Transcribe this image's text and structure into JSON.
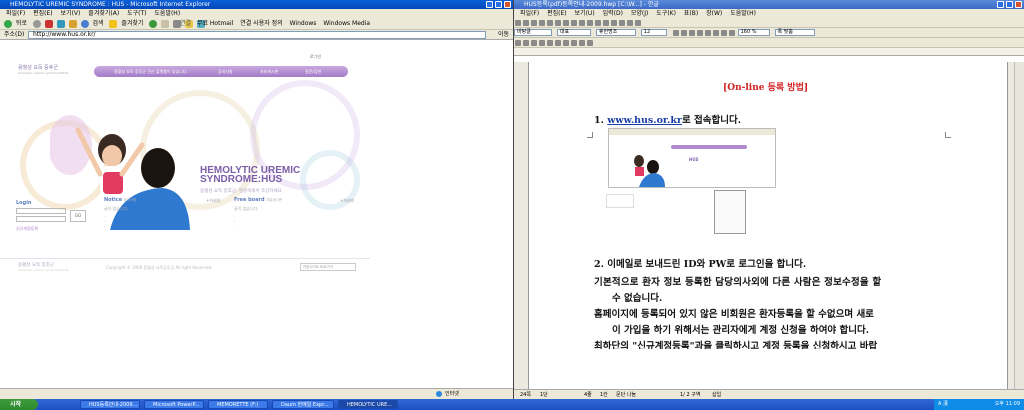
{
  "ie": {
    "title": "HEMOLYTIC UREMIC SYNDROME : HUS - Microsoft Internet Explorer",
    "menu": [
      "파일(F)",
      "편집(E)",
      "보기(V)",
      "즐겨찾기(A)",
      "도구(T)",
      "도움말(H)"
    ],
    "toolbar": {
      "back": "뒤로",
      "search": "검색",
      "favorites": "즐겨찾기"
    },
    "links": {
      "label": "연결",
      "items": [
        "무료 Hotmail",
        "연결 사용자 정의",
        "Windows",
        "Windows Media"
      ]
    },
    "address_label": "주소(D)",
    "address": "http://www.hus.or.kr/",
    "go": "이동",
    "status": "인터넷"
  },
  "site": {
    "utility": "로그인",
    "logo": "용혈성 요독 증후군",
    "logo_sub": "hemolytic uremic syndrome(HUS)",
    "nav": [
      "용혈성 요독 증후군 전산 플랫폼이 있습니다.",
      "공지사항",
      "자유게시판",
      "질문/답변"
    ],
    "hero_title": [
      "HEMOLYTIC UREMIC",
      "SYNDROME:HUS"
    ],
    "hero_sub": "용혈성 요독 증후군, 영원속에서 조심하세요",
    "login": {
      "title": "Login",
      "go": "GO",
      "join": "신규개정등록"
    },
    "notice": {
      "title": "Notice",
      "sub": "공지사항",
      "more": "+자세히",
      "empty": "글이 없습니다."
    },
    "freeboard": {
      "title": "Free board",
      "sub": "자유게시판",
      "more": "+자세히",
      "empty": "글이 없습니다."
    },
    "footer": {
      "logo": "용혈성 요독 증후군",
      "logo_sub": "hemolytic uremic syndrome(HUS)",
      "copyright": "Copyright © 2008 용혈성 요독증후군 All right Reserved.",
      "select": "관련사이트 바로가기"
    }
  },
  "hwp": {
    "title": "HUS등록(pdf)등록안내-2009.hwp [C:\\W...] - 한글",
    "menu": [
      "파일(F)",
      "편집(E)",
      "보기(U)",
      "입력(D)",
      "모양(J)",
      "도구(K)",
      "표(B)",
      "창(W)",
      "도움말(H)"
    ],
    "style": "바탕글",
    "font_lang": "대표",
    "font": "휴먼명조",
    "size": "12",
    "zoom": "160 %",
    "align": "폭 맞춤",
    "doc": {
      "title": "[On-line 등록 방법]",
      "step1_num": "1.",
      "step1_link": "www.hus.or.kr",
      "step1_text": "로 접속합니다.",
      "step2": "2. 이메일로 보내드린 ID와 PW로 로그인을 합니다.",
      "para1a": "기본적으로 환자 정보 등록한 담당의사외에 다른 사람은 정보수정을 할",
      "para1b": "수 없습니다.",
      "para2a": "홈페이지에 등록되어 있지 않은 비회원은 환자등록을 할 수없으며 새로",
      "para2b": "이 가입을 하기 위해서는 관리자에게 계정 신청을 하여야 합니다.",
      "para3": "최하단의 \"신규계정등록\"과을 클릭하시고 계정 등록을 신청하시고 바랍"
    },
    "status": {
      "page": "24쪽",
      "section": "1단",
      "line": "4줄",
      "col": "1칸",
      "text": "문단 나눔",
      "range": "1/ 2 구역",
      "mode": "삽입"
    }
  },
  "taskbar": {
    "start": "시작",
    "tasks": [
      "HUS등록안내-2009...",
      "Microsoft PowerP...",
      "MEMORETTE (F:)",
      "Daum 한메일 Expr...",
      "HEMOLYTIC URE..."
    ],
    "tray_lang": "A 漢",
    "clock": "오후 11:09"
  }
}
